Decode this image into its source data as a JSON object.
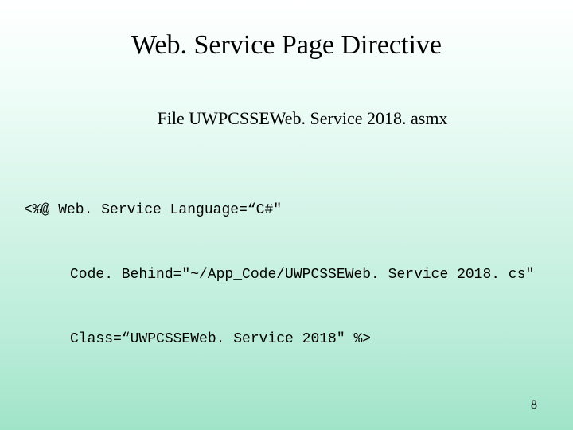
{
  "title": "Web. Service Page Directive",
  "subtitle": "File UWPCSSEWeb. Service 2018. asmx",
  "code": {
    "line1": "<%@ Web. Service Language=“C#\"",
    "line2": "Code. Behind=\"~/App_Code/UWPCSSEWeb. Service 2018. cs\"",
    "line3": "Class=“UWPCSSEWeb. Service 2018\" %>"
  },
  "page_number": "8"
}
